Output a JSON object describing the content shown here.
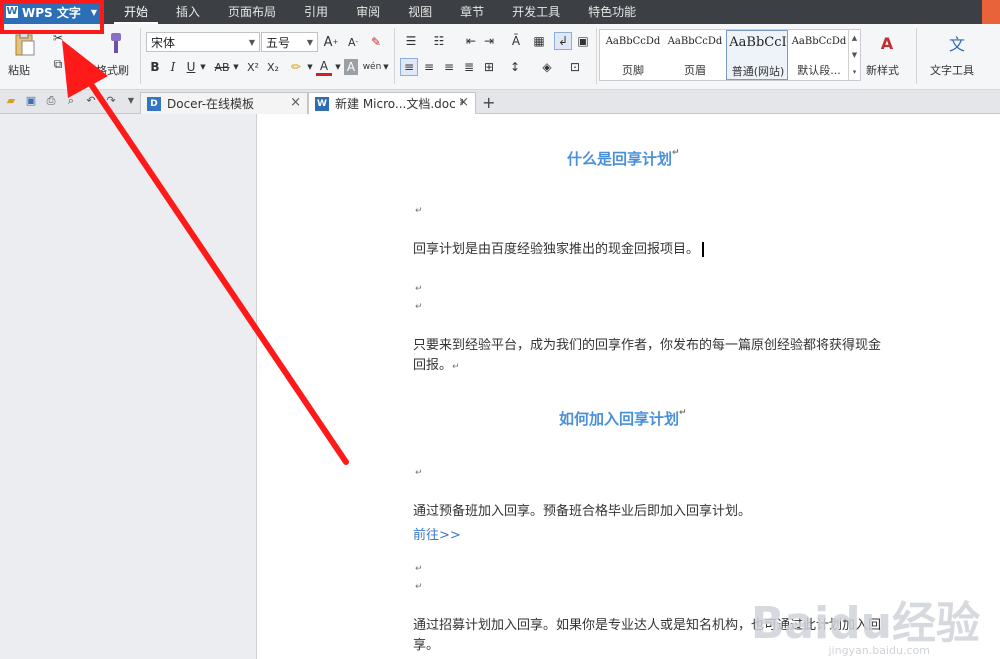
{
  "app": {
    "name": "WPS 文字"
  },
  "menu": {
    "tabs": [
      "开始",
      "插入",
      "页面布局",
      "引用",
      "审阅",
      "视图",
      "章节",
      "开发工具",
      "特色功能"
    ]
  },
  "ribbon": {
    "paste_label": "粘贴",
    "copy_label": "复制",
    "format_painter_label": "格式刷",
    "font_name": "宋体",
    "font_size": "五号",
    "bold": "B",
    "italic": "I",
    "underline": "U",
    "strikethrough": "AB",
    "superscript": "X²",
    "subscript": "X₂",
    "font_color": "A",
    "char_shading": "A",
    "pinyin": "wén",
    "grow_font": "A",
    "shrink_font": "A",
    "styles": [
      {
        "preview": "AaBbCcDd",
        "name": "页脚"
      },
      {
        "preview": "AaBbCcDd",
        "name": "页眉"
      },
      {
        "preview": "AaBbCcI",
        "name": "普通(网站)"
      },
      {
        "preview": "AaBbCcDd",
        "name": "默认段..."
      }
    ],
    "new_style_label": "新样式",
    "text_tools_label": "文字工具"
  },
  "tabs": {
    "docer": "Docer-在线模板",
    "doc": "新建 Micro...文档.doc *"
  },
  "document": {
    "heading1": "什么是回享计划",
    "para1": "回享计划是由百度经验独家推出的现金回报项目。",
    "para2_line1": "只要来到经验平台，成为我们的回享作者，你发布的每一篇原创经验都将获得现金",
    "para2_line2": "回报。",
    "heading2": "如何加入回享计划",
    "para3": "通过预备班加入回享。预备班合格毕业后即加入回享计划。",
    "link": "前往>>",
    "para4_line1": "通过招募计划加入回享。如果你是专业达人或是知名机构，也可通过此计划加入回",
    "para4_line2": "享。"
  },
  "watermark": {
    "text": "Baidu经验",
    "sub": "jingyan.baidu.com"
  },
  "colors": {
    "accent": "#2d6fb6",
    "heading": "#4a90d9",
    "highlight": "#ff1a1a"
  }
}
